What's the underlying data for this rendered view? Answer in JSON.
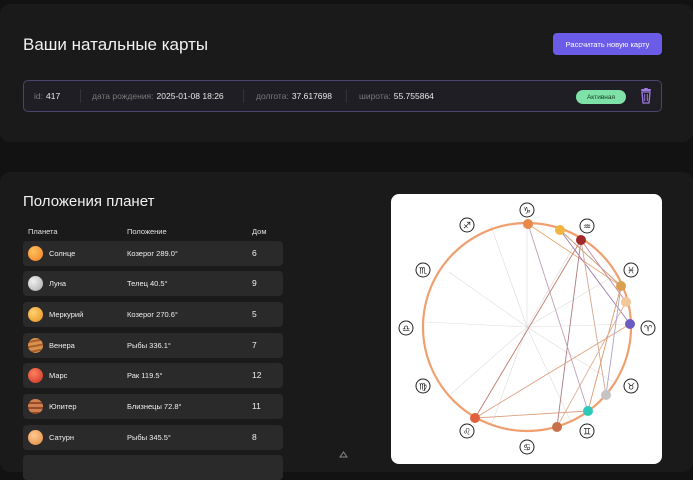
{
  "header": {
    "title": "Ваши натальные карты",
    "new_chart_button": "Рассчитать новую карту"
  },
  "chart_record": {
    "id_label": "id:",
    "id_value": "417",
    "birth_label": "дата рождения:",
    "birth_value": "2025-01-08 18:26",
    "lon_label": "долгота:",
    "lon_value": "37.617698",
    "lat_label": "широта:",
    "lat_value": "55.755864",
    "status": "Активная",
    "delete_icon": "trash-icon"
  },
  "planets_section": {
    "title": "Положения планет",
    "columns": [
      "Планета",
      "Положение",
      "Дом"
    ],
    "rows": [
      {
        "planet": "Солнце",
        "position": "Козерог 289.0°",
        "house": "6",
        "color": "#f39a2c"
      },
      {
        "planet": "Луна",
        "position": "Телец 40.5°",
        "house": "9",
        "color": "#c9c9c9"
      },
      {
        "planet": "Меркурий",
        "position": "Козерог 270.6°",
        "house": "5",
        "color": "#f2a93a"
      },
      {
        "planet": "Венера",
        "position": "Рыбы 336.1°",
        "house": "7",
        "color": "#c77a3a"
      },
      {
        "planet": "Марс",
        "position": "Рак 119.5°",
        "house": "12",
        "color": "#e0473c"
      },
      {
        "planet": "Юпитер",
        "position": "Близнецы 72.8°",
        "house": "11",
        "color": "#c0663c"
      },
      {
        "planet": "Сатурн",
        "position": "Рыбы 345.5°",
        "house": "8",
        "color": "#e8a05a"
      }
    ]
  },
  "wheel": {
    "zodiac_glyphs": [
      "♑",
      "♒",
      "♓",
      "♈",
      "♉",
      "♊",
      "♋",
      "♌",
      "♍",
      "♎",
      "♏",
      "♐"
    ],
    "ring_color": "#f0a070",
    "planet_marks": [
      {
        "name": "planet-dot-1",
        "color": "#e8884a"
      },
      {
        "name": "planet-dot-2",
        "color": "#f2b440"
      },
      {
        "name": "planet-dot-3",
        "color": "#a02828"
      },
      {
        "name": "planet-dot-4",
        "color": "#d9a050"
      },
      {
        "name": "planet-dot-5",
        "color": "#f2c89a"
      },
      {
        "name": "planet-dot-6",
        "color": "#6a5cc0"
      },
      {
        "name": "planet-dot-7",
        "color": "#c4c4c4"
      },
      {
        "name": "planet-dot-8",
        "color": "#2ec8b8"
      },
      {
        "name": "planet-dot-9",
        "color": "#c8704a"
      },
      {
        "name": "planet-dot-10",
        "color": "#e0603c"
      }
    ]
  },
  "colors": {
    "accent": "#6b5ce7",
    "badge": "#7ee2a8",
    "trash": "#9d7be0"
  }
}
